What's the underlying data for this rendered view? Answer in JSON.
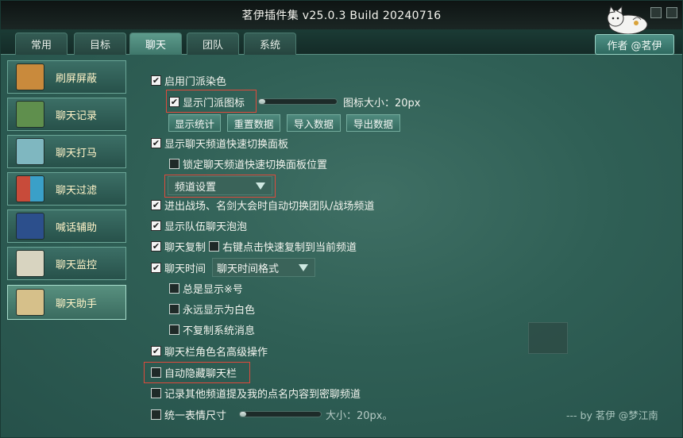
{
  "window": {
    "title": "茗伊插件集 v25.0.3 Build 20240716",
    "author": "作者 @茗伊",
    "footer": "--- by 茗伊 @梦江南"
  },
  "tabs": [
    "常用",
    "目标",
    "聊天",
    "团队",
    "系统"
  ],
  "active_tab": "聊天",
  "sidebar": {
    "items": [
      {
        "label": "刷屏屏蔽",
        "icon": "scroll-block-icon",
        "color": "#c98a3c"
      },
      {
        "label": "聊天记录",
        "icon": "chat-log-icon",
        "color": "#5f8f4d"
      },
      {
        "label": "聊天打马",
        "icon": "horse-icon",
        "color": "#7fb7c0"
      },
      {
        "label": "聊天过滤",
        "icon": "filter-icon",
        "color": "#c84b3a"
      },
      {
        "label": "喊话辅助",
        "icon": "rabbit-icon",
        "color": "#2c4f8c"
      },
      {
        "label": "聊天监控",
        "icon": "monitor-icon",
        "color": "#d8d4c0"
      },
      {
        "label": "聊天助手",
        "icon": "quill-icon",
        "color": "#d6c08a"
      }
    ],
    "active_index": 6
  },
  "options": {
    "school_color": "启用门派染色",
    "show_school_icon": "显示门派图标",
    "icon_size": "图标大小：20px",
    "icon_size_value": 0.05,
    "buttons": [
      "显示统计",
      "重置数据",
      "导入数据",
      "导出数据"
    ],
    "show_switch_panel": "显示聊天频道快速切换面板",
    "lock_switch_panel": "锁定聊天频道快速切换面板位置",
    "channel_settings": "频道设置",
    "auto_switch_team": "进出战场、名剑大会时自动切换团队/战场频道",
    "show_team_bubble": "显示队伍聊天泡泡",
    "chat_copy": "聊天复制",
    "right_click_copy": "右键点击快速复制到当前频道",
    "chat_time": "聊天时间",
    "time_format": "聊天时间格式",
    "always_show_hash": "总是显示※号",
    "always_white": "永远显示为白色",
    "no_copy_system": "不复制系统消息",
    "advanced_name_ops": "聊天栏角色名高级操作",
    "auto_hide_chat": "自动隐藏聊天栏",
    "record_mentions": "记录其他频道提及我的点名内容到密聊频道",
    "unify_emoji": "统一表情尺寸",
    "emoji_size": "大小：20px。",
    "emoji_size_value": 0.05
  },
  "checked": {
    "school_color": true,
    "show_school_icon": true,
    "show_switch_panel": true,
    "lock_switch_panel": false,
    "auto_switch_team": true,
    "show_team_bubble": true,
    "chat_copy": true,
    "right_click_copy": false,
    "chat_time": true,
    "always_show_hash": false,
    "always_white": false,
    "no_copy_system": false,
    "advanced_name_ops": true,
    "auto_hide_chat": false,
    "record_mentions": false,
    "unify_emoji": false
  }
}
